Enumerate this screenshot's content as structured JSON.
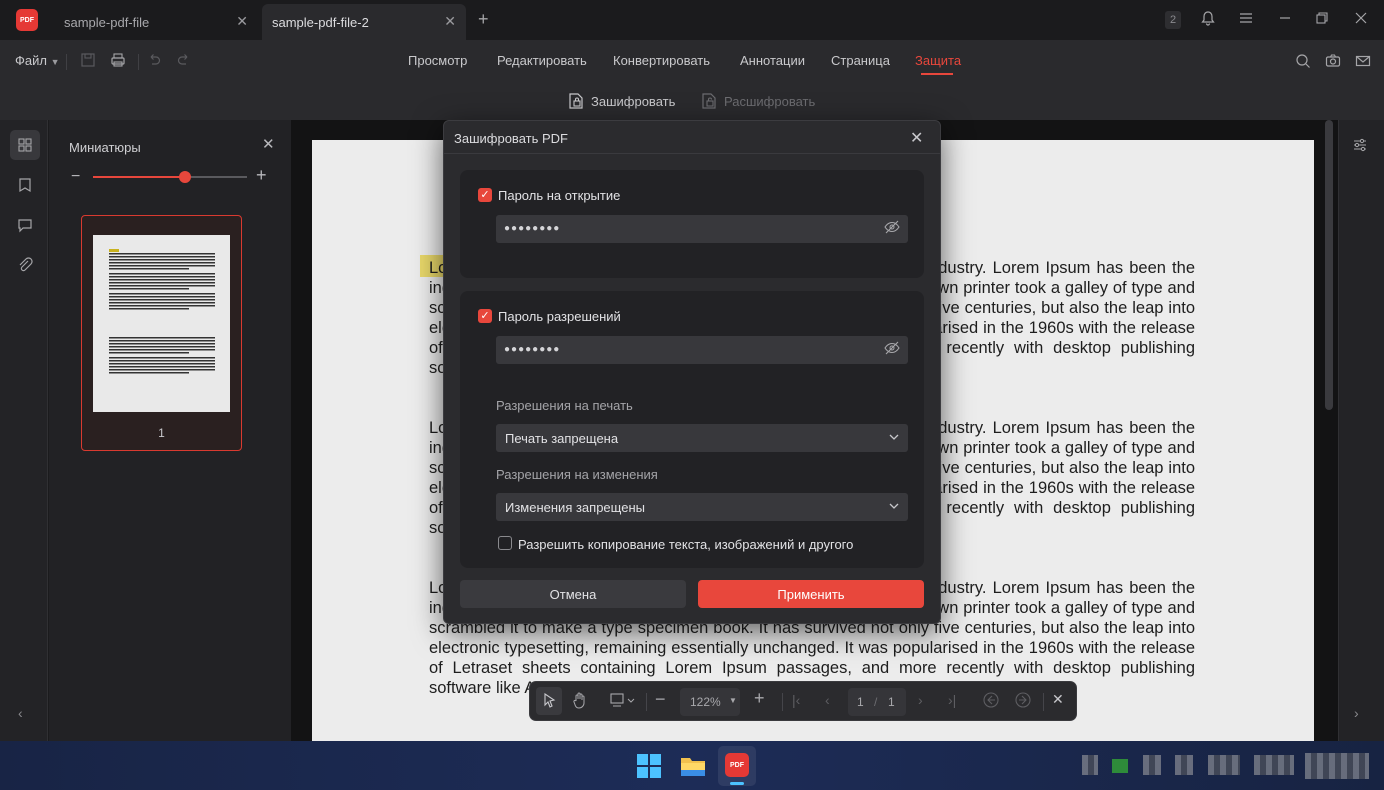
{
  "tabs": [
    {
      "label": "sample-pdf-file",
      "active": false
    },
    {
      "label": "sample-pdf-file-2",
      "active": true
    }
  ],
  "app_logo": "PDF",
  "notifications_badge": "2",
  "menu": {
    "file_label": "Файл",
    "items": [
      "Просмотр",
      "Редактировать",
      "Конвертировать",
      "Аннотации",
      "Страница",
      "Защита"
    ],
    "active": "Защита"
  },
  "subtoolbar": {
    "encrypt_label": "Зашифровать",
    "decrypt_label": "Расшифровать"
  },
  "thumbnails": {
    "title": "Миниатюры",
    "page_number": "1",
    "zoom_slider_fraction": 0.6
  },
  "document": {
    "paragraph_text": "Lorem Ipsum is simply dummy text of the printing and typesetting industry. Lorem Ipsum has been the industry's standard dummy text ever since the 1500s, when an unknown printer took a galley of type and scrambled it to make a type specimen book. It has survived not only five centuries, but also the leap into electronic typesetting, remaining essentially unchanged. It was popularised in the 1960s with the release of Letraset sheets containing Lorem Ipsum passages, and more recently with desktop publishing software like Aldus PageMaker including versions of Lorem Ipsum."
  },
  "bottom_toolbar": {
    "zoom": "122%",
    "page_current": "1",
    "page_separator": "/",
    "page_total": "1"
  },
  "dialog": {
    "title": "Зашифровать PDF",
    "open_password": {
      "checked": true,
      "label": "Пароль на открытие",
      "value": "●●●●●●●●"
    },
    "permissions_password": {
      "checked": true,
      "label": "Пароль разрешений",
      "value": "●●●●●●●●"
    },
    "print_permissions": {
      "label": "Разрешения на печать",
      "selected": "Печать запрещена"
    },
    "change_permissions": {
      "label": "Разрешения на изменения",
      "selected": "Изменения запрещены"
    },
    "allow_copy": {
      "checked": false,
      "label": "Разрешить копирование текста, изображений и другого"
    },
    "cancel_label": "Отмена",
    "apply_label": "Применить"
  },
  "colors": {
    "accent": "#e8473c",
    "background": "#1b1b1d",
    "panel": "#2a2a2d"
  }
}
